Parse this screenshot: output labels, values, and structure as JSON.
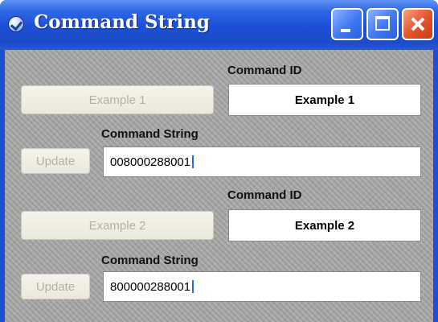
{
  "window": {
    "title": "Command String",
    "icon": "app-check-icon",
    "controls": [
      "minimize-icon",
      "maximize-icon",
      "close-icon"
    ]
  },
  "row1": {
    "id_label": "Command ID",
    "example_button": "Example 1",
    "id_value": "Example 1",
    "string_label": "Command String",
    "update_button": "Update",
    "string_value": "008000288001"
  },
  "row2": {
    "id_label": "Command ID",
    "example_button": "Example 2",
    "id_value": "Example 2",
    "string_label": "Command String",
    "update_button": "Update",
    "string_value": "800000288001"
  },
  "colors": {
    "titlebar": "#1c4fd2",
    "close_button": "#e3572d",
    "client_background": "#a9a9a9",
    "disabled_text": "#b3b1a6",
    "caret": "#2b6fd6"
  }
}
